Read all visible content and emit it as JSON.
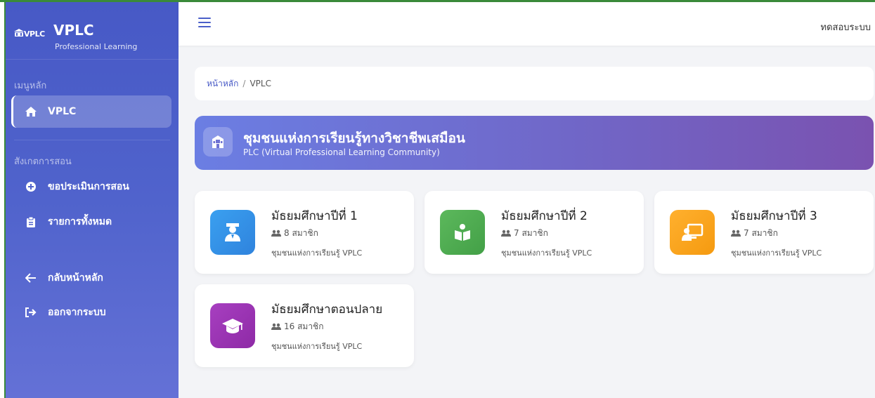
{
  "sidebar": {
    "logo_text": "VPLC",
    "brand_title": "VPLC",
    "brand_subtitle": "Professional Learning",
    "section_main": "เมนูหลัก",
    "item_vplc": "VPLC",
    "section_observe": "สังเกตการสอน",
    "item_request": "ขอประเมินการสอน",
    "item_list": "รายการทั้งหมด",
    "item_back": "กลับหน้าหลัก",
    "item_logout": "ออกจากระบบ"
  },
  "topbar": {
    "user": "ทดสอบระบบ"
  },
  "breadcrumb": {
    "home": "หน้าหลัก",
    "separator": "/",
    "current": "VPLC"
  },
  "banner": {
    "title": "ชุมชนแห่งการเรียนรู้ทางวิชาชีพเสมือน",
    "subtitle": "PLC (Virtual Professional Learning Community)"
  },
  "cards": [
    {
      "title": "มัธยมศึกษาปีที่ 1",
      "members": "8 สมาชิก",
      "desc": "ชุมชนแห่งการเรียนรู้ VPLC",
      "icon": "teacher-icon",
      "color": "#2f8de4"
    },
    {
      "title": "มัธยมศึกษาปีที่ 2",
      "members": "7 สมาชิก",
      "desc": "ชุมชนแห่งการเรียนรู้ VPLC",
      "icon": "book-reader-icon",
      "color": "#4caf50"
    },
    {
      "title": "มัธยมศึกษาปีที่ 3",
      "members": "7 สมาชิก",
      "desc": "ชุมชนแห่งการเรียนรู้ VPLC",
      "icon": "chalkboard-teacher-icon",
      "color": "#f5a21b"
    },
    {
      "title": "มัธยมศึกษาตอนปลาย",
      "members": "16 สมาชิก",
      "desc": "ชุมชนแห่งการเรียนรู้ VPLC",
      "icon": "graduation-cap-icon",
      "color": "#9c35b5"
    }
  ]
}
